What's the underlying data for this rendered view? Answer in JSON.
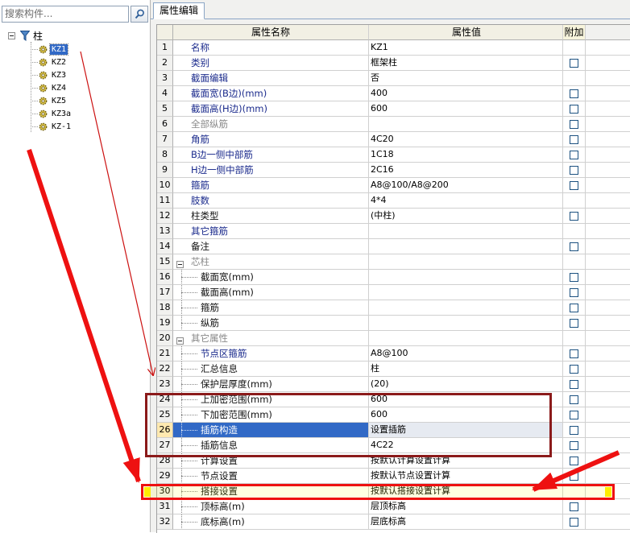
{
  "search": {
    "placeholder": "搜索构件..."
  },
  "tree": {
    "root_label": "柱",
    "items": [
      "KZ1",
      "KZ2",
      "KZ3",
      "KZ4",
      "KZ5",
      "KZ3a",
      "KZ-1"
    ]
  },
  "tab": {
    "label": "属性编辑"
  },
  "grid": {
    "headers": {
      "name": "属性名称",
      "value": "属性值",
      "add": "附加"
    },
    "rows": [
      {
        "num": "1",
        "name": "名称",
        "value": "KZ1"
      },
      {
        "num": "2",
        "name": "类别",
        "value": "框架柱"
      },
      {
        "num": "3",
        "name": "截面编辑",
        "value": "否"
      },
      {
        "num": "4",
        "name": "截面宽(B边)(mm)",
        "value": "400"
      },
      {
        "num": "5",
        "name": "截面高(H边)(mm)",
        "value": "600"
      },
      {
        "num": "6",
        "name": "全部纵筋",
        "value": ""
      },
      {
        "num": "7",
        "name": "角筋",
        "value": "4C20"
      },
      {
        "num": "8",
        "name": "B边一侧中部筋",
        "value": "1C18"
      },
      {
        "num": "9",
        "name": "H边一侧中部筋",
        "value": "2C16"
      },
      {
        "num": "10",
        "name": "箍筋",
        "value": "A8@100/A8@200"
      },
      {
        "num": "11",
        "name": "肢数",
        "value": "4*4"
      },
      {
        "num": "12",
        "name": "柱类型",
        "value": "(中柱)"
      },
      {
        "num": "13",
        "name": "其它箍筋",
        "value": ""
      },
      {
        "num": "14",
        "name": "备注",
        "value": ""
      },
      {
        "num": "15",
        "name": "芯柱",
        "value": ""
      },
      {
        "num": "16",
        "name": "截面宽(mm)",
        "value": ""
      },
      {
        "num": "17",
        "name": "截面高(mm)",
        "value": ""
      },
      {
        "num": "18",
        "name": "箍筋",
        "value": ""
      },
      {
        "num": "19",
        "name": "纵筋",
        "value": ""
      },
      {
        "num": "20",
        "name": "其它属性",
        "value": ""
      },
      {
        "num": "21",
        "name": "节点区箍筋",
        "value": "A8@100"
      },
      {
        "num": "22",
        "name": "汇总信息",
        "value": "柱"
      },
      {
        "num": "23",
        "name": "保护层厚度(mm)",
        "value": "(20)"
      },
      {
        "num": "24",
        "name": "上加密范围(mm)",
        "value": "600"
      },
      {
        "num": "25",
        "name": "下加密范围(mm)",
        "value": "600"
      },
      {
        "num": "26",
        "name": "插筋构造",
        "value": "设置插筋"
      },
      {
        "num": "27",
        "name": "插筋信息",
        "value": "4C22"
      },
      {
        "num": "28",
        "name": "计算设置",
        "value": "按默认计算设置计算"
      },
      {
        "num": "29",
        "name": "节点设置",
        "value": "按默认节点设置计算"
      },
      {
        "num": "30",
        "name": "搭接设置",
        "value": "按默认搭接设置计算"
      },
      {
        "num": "31",
        "name": "顶标高(m)",
        "value": "层顶标高"
      },
      {
        "num": "32",
        "name": "底标高(m)",
        "value": "层底标高"
      }
    ]
  },
  "colors": {
    "selection": "#3169c6",
    "annotation_red": "#ee1111",
    "annotation_darkred": "#8b1a1a",
    "name_blue": "#1a2a8c"
  },
  "icons": {
    "search": "magnifier-icon",
    "root": "filter-funnel-icon",
    "item": "gear-icon"
  }
}
